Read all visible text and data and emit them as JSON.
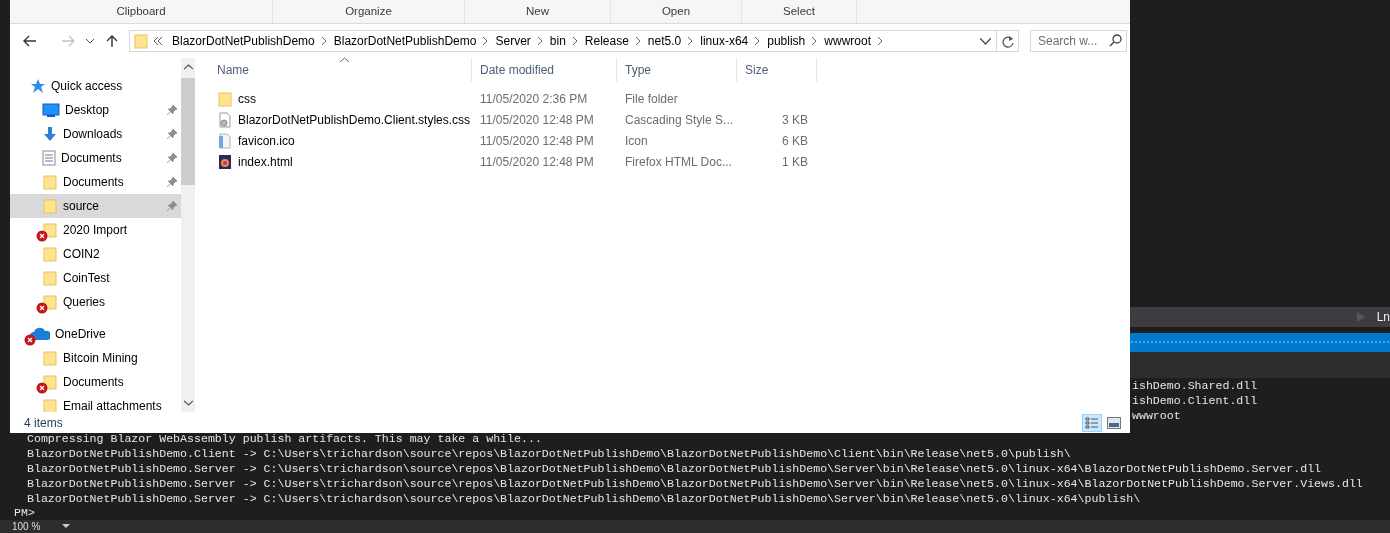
{
  "ribbon_groups": [
    "Clipboard",
    "Organize",
    "New",
    "Open",
    "Select"
  ],
  "address_bar": {
    "forward_disabled": true,
    "segments": [
      "BlazorDotNetPublishDemo",
      "BlazorDotNetPublishDemo",
      "Server",
      "bin",
      "Release",
      "net5.0",
      "linux-x64",
      "publish",
      "wwwroot"
    ],
    "search_placeholder": "Search w..."
  },
  "nav_pane": [
    {
      "label": "Quick access",
      "kind": "star",
      "sync_error": false,
      "children": [
        {
          "label": "Desktop",
          "kind": "desktop",
          "pinned": true,
          "selected": false,
          "sync_error": false
        },
        {
          "label": "Downloads",
          "kind": "download",
          "pinned": true,
          "selected": false,
          "sync_error": false
        },
        {
          "label": "Documents",
          "kind": "document",
          "pinned": true,
          "selected": false,
          "sync_error": false
        },
        {
          "label": "Documents",
          "kind": "folder",
          "pinned": true,
          "selected": false,
          "sync_error": false
        },
        {
          "label": "source",
          "kind": "folder",
          "pinned": true,
          "selected": true,
          "sync_error": false
        },
        {
          "label": "2020 Import",
          "kind": "folder",
          "pinned": false,
          "selected": false,
          "sync_error": true
        },
        {
          "label": "COIN2",
          "kind": "folder",
          "pinned": false,
          "selected": false,
          "sync_error": false
        },
        {
          "label": "CoinTest",
          "kind": "folder",
          "pinned": false,
          "selected": false,
          "sync_error": false
        },
        {
          "label": "Queries",
          "kind": "folder",
          "pinned": false,
          "selected": false,
          "sync_error": true
        }
      ]
    },
    {
      "label": "OneDrive",
      "kind": "cloud",
      "sync_error": true,
      "children": [
        {
          "label": "Bitcoin Mining",
          "kind": "folder",
          "pinned": false,
          "selected": false,
          "sync_error": false
        },
        {
          "label": "Documents",
          "kind": "folder",
          "pinned": false,
          "selected": false,
          "sync_error": true
        },
        {
          "label": "Email attachments",
          "kind": "folder",
          "pinned": false,
          "selected": false,
          "sync_error": false
        }
      ]
    }
  ],
  "columns": [
    {
      "label": "Name",
      "sorted": true
    },
    {
      "label": "Date modified",
      "sorted": false
    },
    {
      "label": "Type",
      "sorted": false
    },
    {
      "label": "Size",
      "sorted": false
    }
  ],
  "files": [
    {
      "name": "css",
      "date": "11/05/2020 2:36 PM",
      "type": "File folder",
      "kind": "folder"
    },
    {
      "name": "BlazorDotNetPublishDemo.Client.styles.css",
      "date": "11/05/2020 12:48 PM",
      "type": "Cascading Style S...",
      "size": "3 KB",
      "kind": "css"
    },
    {
      "name": "favicon.ico",
      "date": "11/05/2020 12:48 PM",
      "type": "Icon",
      "size": "6 KB",
      "kind": "ico"
    },
    {
      "name": "index.html",
      "date": "11/05/2020 12:48 PM",
      "type": "Firefox HTML Doc...",
      "size": "1 KB",
      "kind": "html"
    }
  ],
  "status_bar": {
    "item_count": "4 items",
    "views": [
      {
        "kind": "details",
        "selected": true
      },
      {
        "kind": "large_icons",
        "selected": false
      }
    ]
  },
  "ide": {
    "toolbar_text": "Ln",
    "behind_lines": [
      "ishDemo.Shared.dll",
      "ishDemo.Client.dll",
      "wwwroot"
    ],
    "output_lines": [
      "Compressing Blazor WebAssembly publish artifacts. This may take a while...",
      "BlazorDotNetPublishDemo.Client -> C:\\Users\\trichardson\\source\\repos\\BlazorDotNetPublishDemo\\BlazorDotNetPublishDemo\\Client\\bin\\Release\\net5.0\\publish\\",
      "BlazorDotNetPublishDemo.Server -> C:\\Users\\trichardson\\source\\repos\\BlazorDotNetPublishDemo\\BlazorDotNetPublishDemo\\Server\\bin\\Release\\net5.0\\linux-x64\\BlazorDotNetPublishDemo.Server.dll",
      "BlazorDotNetPublishDemo.Server -> C:\\Users\\trichardson\\source\\repos\\BlazorDotNetPublishDemo\\BlazorDotNetPublishDemo\\Server\\bin\\Release\\net5.0\\linux-x64\\BlazorDotNetPublishDemo.Server.Views.dll",
      "BlazorDotNetPublishDemo.Server -> C:\\Users\\trichardson\\source\\repos\\BlazorDotNetPublishDemo\\BlazorDotNetPublishDemo\\Server\\bin\\Release\\net5.0\\linux-x64\\publish\\"
    ],
    "prompt": "PM>",
    "zoom": "100 %"
  }
}
